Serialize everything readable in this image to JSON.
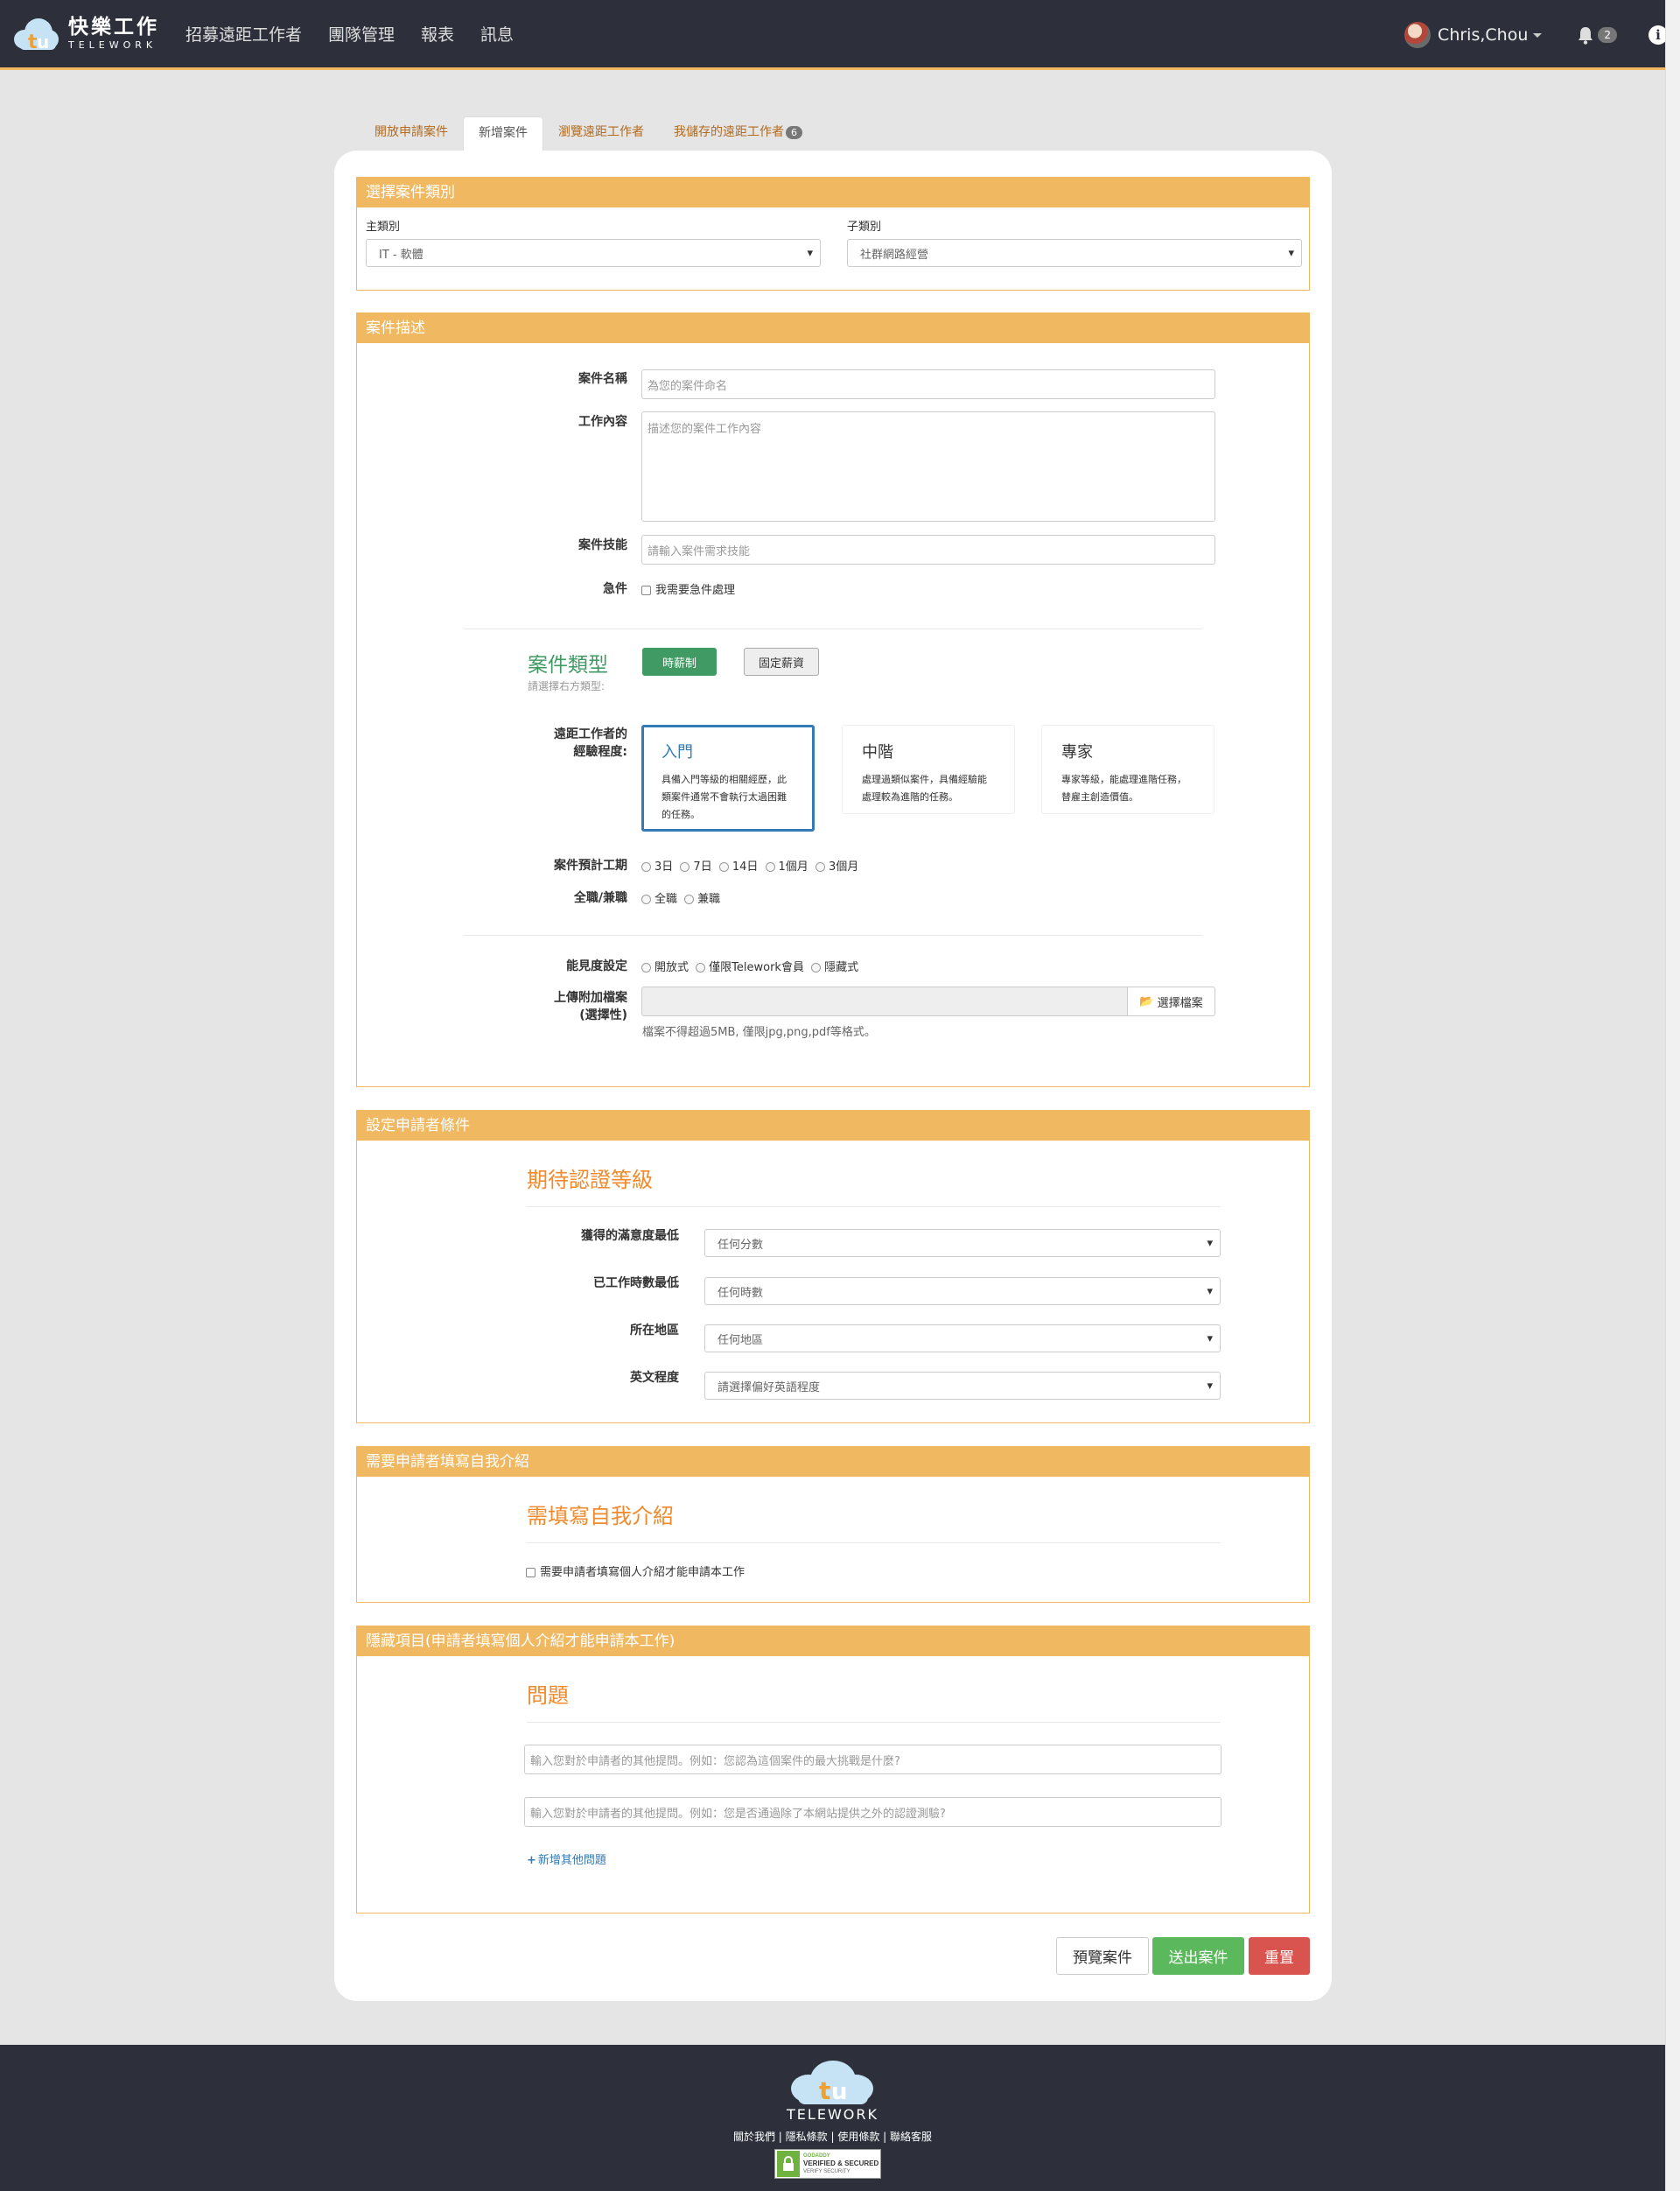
{
  "nav": {
    "brand_cn": "快樂工作",
    "brand_en": "TELEWORK",
    "items": [
      "招募遠距工作者",
      "團隊管理",
      "報表",
      "訊息"
    ],
    "username": "Chris,Chou",
    "notification_count": "2"
  },
  "tabs": [
    {
      "label": "開放申請案件"
    },
    {
      "label": "新增案件"
    },
    {
      "label": "瀏覽遠距工作者"
    },
    {
      "label": "我儲存的遠距工作者",
      "count": "6"
    }
  ],
  "category": {
    "title": "選擇案件類別",
    "main_label": "主類別",
    "main_value": "IT - 軟體",
    "sub_label": "子類別",
    "sub_value": "社群網路經營"
  },
  "description": {
    "title": "案件描述",
    "name_label": "案件名稱",
    "name_placeholder": "為您的案件命名",
    "content_label": "工作內容",
    "content_placeholder": "描述您的案件工作內容",
    "skills_label": "案件技能",
    "skills_placeholder": "請輸入案件需求技能",
    "urgent_label": "急件",
    "urgent_option": "我需要急件處理",
    "type_title": "案件類型",
    "type_hint": "請選擇右方類型:",
    "type_hourly": "時薪制",
    "type_fixed": "固定薪資",
    "exp_label_1": "遠距工作者的",
    "exp_label_2": "經驗程度:",
    "levels": [
      {
        "title": "入門",
        "desc": "具備入門等級的相關經歷，此類案件通常不會執行太過困難的任務。"
      },
      {
        "title": "中階",
        "desc": "處理過類似案件，具備經驗能處理較為進階的任務。"
      },
      {
        "title": "專家",
        "desc": "專家等級，能處理進階任務，替雇主創造價值。"
      }
    ],
    "duration_label": "案件預計工期",
    "durations": [
      "3日",
      "7日",
      "14日",
      "1個月",
      "3個月"
    ],
    "fulltime_label": "全職/兼職",
    "fulltime_options": [
      "全職",
      "兼職"
    ],
    "visibility_label": "能見度設定",
    "visibility_options": [
      "開放式",
      "僅限Telework會員",
      "隱藏式"
    ],
    "upload_label_1": "上傳附加檔案",
    "upload_label_2": "(選擇性)",
    "upload_button": "選擇檔案",
    "upload_hint": "檔案不得超過5MB, 僅限jpg,png,pdf等格式。"
  },
  "applicant": {
    "title": "設定申請者條件",
    "subtitle": "期待認證等級",
    "rows": [
      {
        "label": "獲得的滿意度最低",
        "value": "任何分數"
      },
      {
        "label": "已工作時數最低",
        "value": "任何時數"
      },
      {
        "label": "所在地區",
        "value": "任何地區"
      },
      {
        "label": "英文程度",
        "value": "請選擇偏好英語程度"
      }
    ]
  },
  "intro": {
    "title": "需要申請者填寫自我介紹",
    "subtitle": "需填寫自我介紹",
    "checkbox": "需要申請者填寫個人介紹才能申請本工作"
  },
  "hidden": {
    "title": "隱藏項目(申請者填寫個人介紹才能申請本工作)",
    "subtitle": "問題",
    "q1_placeholder": "輸入您對於申請者的其他提問。例如：您認為這個案件的最大挑戰是什麼?",
    "q2_placeholder": "輸入您對於申請者的其他提問。例如：您是否通過除了本網站提供之外的認證測驗?",
    "add_question": "新增其他問題"
  },
  "actions": {
    "preview": "預覽案件",
    "submit": "送出案件",
    "reset": "重置"
  },
  "footer": {
    "brand_en": "TELEWORK",
    "links": [
      "關於我們",
      "隱私條款",
      "使用條款",
      "聯絡客服"
    ],
    "seal_top": "GODADDY",
    "seal_main": "VERIFIED & SECURED",
    "seal_sub": "VERIFY SECURITY"
  },
  "colors": {
    "navbar": "#2d303b",
    "panel_header": "#f0b860",
    "orange_heading": "#f08a2c",
    "green_primary": "#3f9a63",
    "submit_green": "#5cb85c",
    "reset_red": "#d9534f",
    "selected_blue": "#337ab7"
  }
}
